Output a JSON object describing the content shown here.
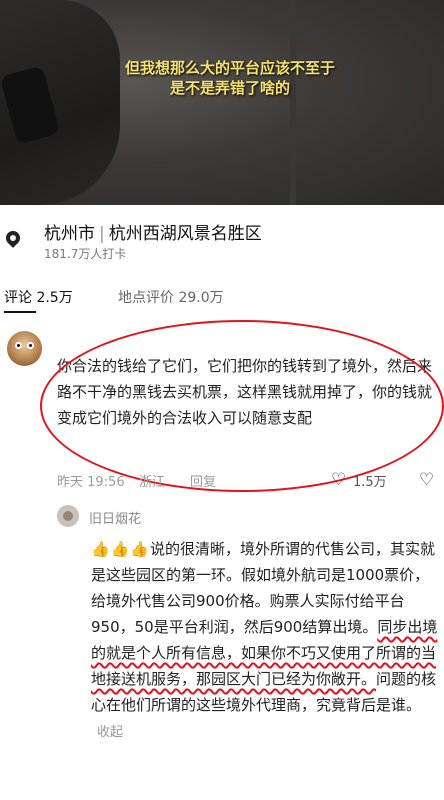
{
  "video": {
    "subtitle_line1": "但我想那么大的平台应该不至于",
    "subtitle_line2": "是不是弄错了啥的"
  },
  "location": {
    "icon": "location-pin-icon",
    "city": "杭州市",
    "place": "杭州西湖风景名胜区",
    "checkins": "181.7万人打卡"
  },
  "tabs": {
    "comments": "评论 2.5万",
    "place_reviews": "地点评价 29.0万"
  },
  "comment": {
    "text": "你合法的钱给了它们，它们把你的钱转到了境外，然后来路不干净的黑钱去买机票，这样黑钱就用掉了，你的钱就变成它们境外的合法收入可以随意支配",
    "time": "昨天 19:56",
    "region": "浙江",
    "reply_label": "回复",
    "likes": "1.5万"
  },
  "reply": {
    "username": "旧日烟花",
    "thumbs": "👍👍👍",
    "text_part1": "说的很清晰，境外所谓的代售公司，其实就是这些园区的第一环。假如境外航司是1000票价，给境外代售公司900价格。购票人实际付给平台950，50是平台利润，然后900结算出境。",
    "text_underlined": "同步出境的就是个人所有信息，如果你不巧又使用了所谓的当地接送机服务，那园区大门已经为你敞开。",
    "text_part2": "问题的核心在他们所谓的这些境外代理商，究竟背后是谁。",
    "collapse_label": "收起"
  }
}
